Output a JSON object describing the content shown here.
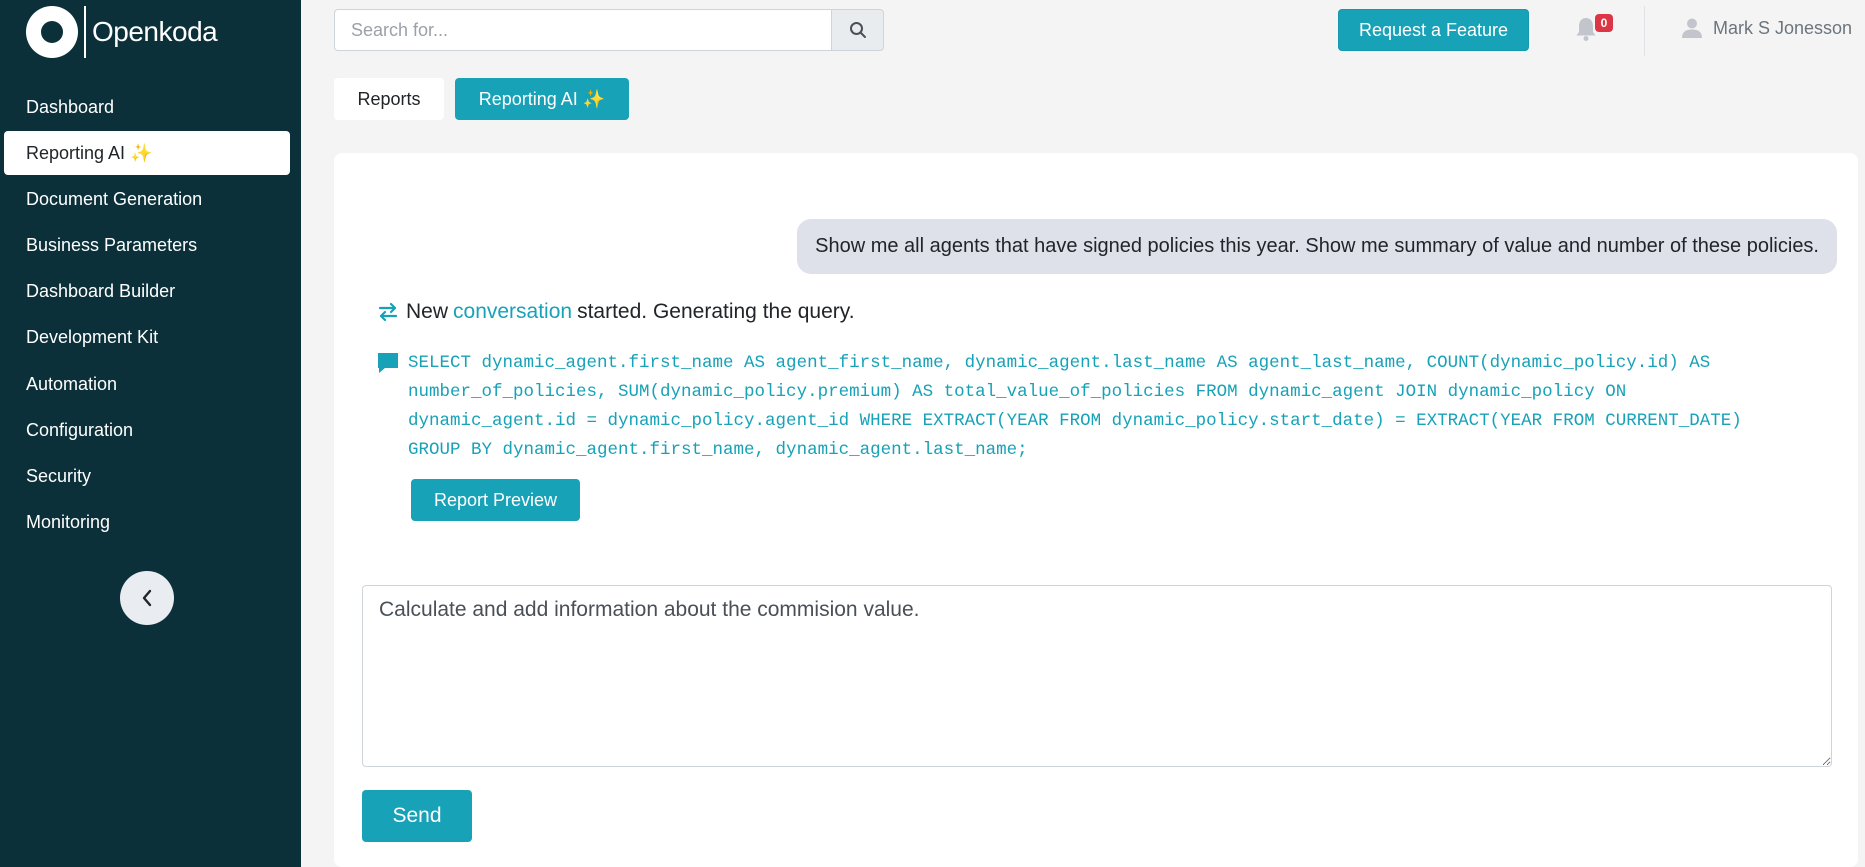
{
  "app": {
    "name": "Openkoda"
  },
  "sidebar": {
    "items": [
      {
        "label": "Dashboard",
        "active": false
      },
      {
        "label": "Reporting AI ✨",
        "active": true
      },
      {
        "label": "Document Generation",
        "active": false
      },
      {
        "label": "Business Parameters",
        "active": false
      },
      {
        "label": "Dashboard Builder",
        "active": false
      },
      {
        "label": "Development Kit",
        "active": false
      },
      {
        "label": "Automation",
        "active": false
      },
      {
        "label": "Configuration",
        "active": false
      },
      {
        "label": "Security",
        "active": false
      },
      {
        "label": "Monitoring",
        "active": false
      }
    ],
    "collapse_icon": "chevron-left-icon"
  },
  "header": {
    "search": {
      "placeholder": "Search for...",
      "value": ""
    },
    "request_feature_label": "Request a Feature",
    "notifications_count": "0",
    "user_name": "Mark S Jonesson"
  },
  "tabs": [
    {
      "label": "Reports",
      "active": false
    },
    {
      "label": "Reporting AI ✨",
      "active": true
    }
  ],
  "chat": {
    "user_message": "Show me all agents that have signed policies this year. Show me summary of value and number of these policies.",
    "status_prefix": "New",
    "status_link": "conversation",
    "status_suffix": "started. Generating the query.",
    "sql": "SELECT dynamic_agent.first_name AS agent_first_name, dynamic_agent.last_name AS agent_last_name, COUNT(dynamic_policy.id) AS number_of_policies, SUM(dynamic_policy.premium) AS total_value_of_policies FROM dynamic_agent JOIN dynamic_policy ON dynamic_agent.id = dynamic_policy.agent_id WHERE EXTRACT(YEAR FROM dynamic_policy.start_date) = EXTRACT(YEAR FROM CURRENT_DATE) GROUP BY dynamic_agent.first_name, dynamic_agent.last_name;",
    "report_preview_label": "Report Preview",
    "prompt_value": "Calculate and add information about the commision value.",
    "send_label": "Send"
  },
  "colors": {
    "sidebar_bg": "#0b3039",
    "accent": "#17a2b8",
    "badge": "#dc3545",
    "bubble": "#dee0ea"
  }
}
